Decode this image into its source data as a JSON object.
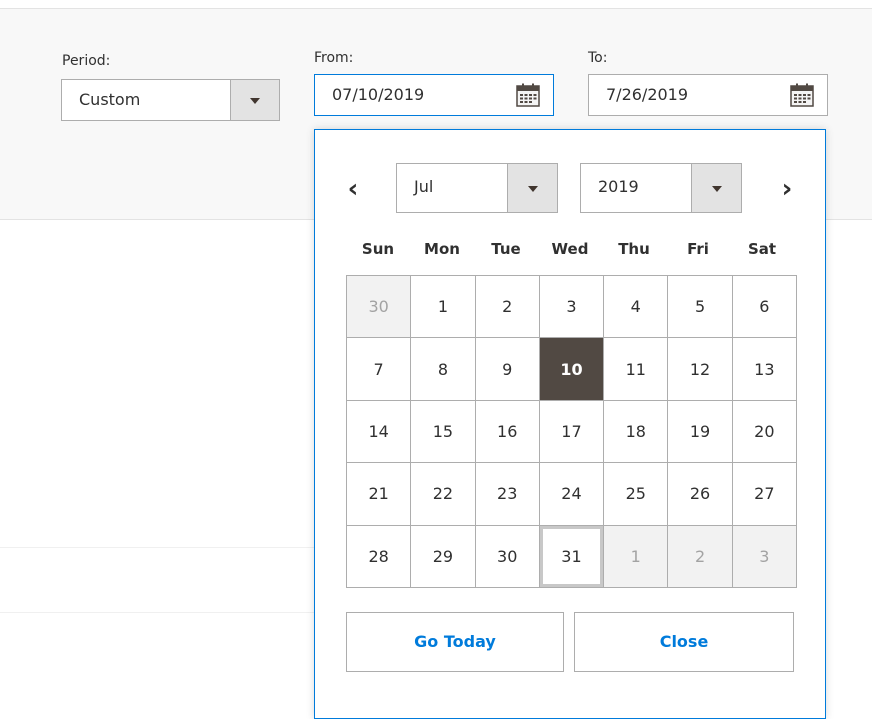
{
  "filters": {
    "period_label": "Period:",
    "period_value": "Custom",
    "from_label": "From:",
    "from_value": "07/10/2019",
    "to_label": "To:",
    "to_value": "7/26/2019"
  },
  "calendar": {
    "prev_glyph": "‹",
    "next_glyph": "›",
    "month": "Jul",
    "year": "2019",
    "weekdays": [
      "Sun",
      "Mon",
      "Tue",
      "Wed",
      "Thu",
      "Fri",
      "Sat"
    ],
    "weeks": [
      [
        "30",
        "1",
        "2",
        "3",
        "4",
        "5",
        "6"
      ],
      [
        "7",
        "8",
        "9",
        "10",
        "11",
        "12",
        "13"
      ],
      [
        "14",
        "15",
        "16",
        "17",
        "18",
        "19",
        "20"
      ],
      [
        "21",
        "22",
        "23",
        "24",
        "25",
        "26",
        "27"
      ],
      [
        "28",
        "29",
        "30",
        "31",
        "1",
        "2",
        "3"
      ]
    ],
    "other_month_cells": [
      "0-0",
      "4-4",
      "4-5",
      "4-6"
    ],
    "selected_cell": "1-3",
    "today_cell": "4-3",
    "go_today_label": "Go Today",
    "close_label": "Close"
  },
  "icons": {
    "calendar": "calendar-icon",
    "prev": "chevron-left-icon",
    "next": "chevron-right-icon",
    "dropdown": "chevron-down-icon"
  },
  "colors": {
    "accent": "#007bdb",
    "selected_bg": "#514943",
    "border": "#adadad"
  }
}
